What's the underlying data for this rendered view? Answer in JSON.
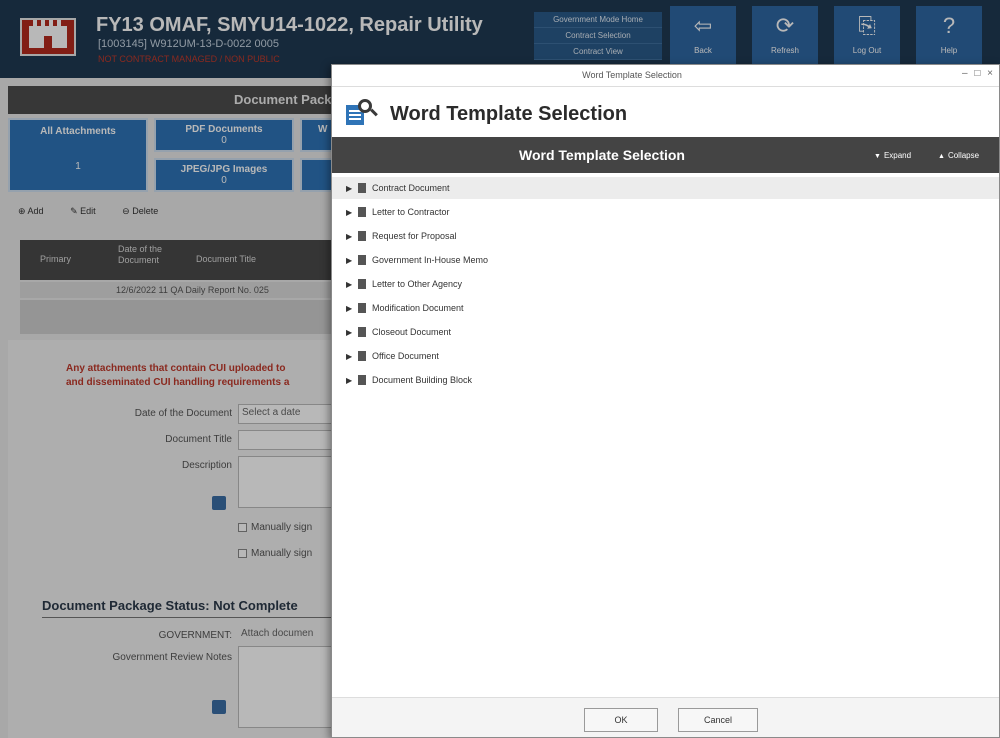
{
  "app": {
    "title": "FY13 OMAF, SMYU14-1022, Repair Utility",
    "subtitle": "[1003145] W912UM-13-D-0022 0005",
    "subtitle_note": "NOT CONTRACT MANAGED / NON PUBLIC",
    "header_links": [
      "Government Mode Home",
      "Contract Selection",
      "Contract View"
    ],
    "header_buttons": [
      {
        "label": "Back",
        "icon": "back-arrow-icon"
      },
      {
        "label": "Refresh",
        "icon": "refresh-icon"
      },
      {
        "label": "Log Out",
        "icon": "logout-icon"
      },
      {
        "label": "Help",
        "icon": "help-icon"
      }
    ],
    "document_title_bar": "Document Package",
    "tiles": {
      "all": {
        "label": "All Attachments",
        "count": "1"
      },
      "pdf": {
        "label": "PDF Documents",
        "count": "0"
      },
      "jpeg": {
        "label": "JPEG/JPG Images",
        "count": "0"
      },
      "word": {
        "label": "W"
      }
    },
    "toolbar": {
      "add": "Add",
      "edit": "Edit",
      "delete": "Delete"
    },
    "grid": {
      "columns": [
        "Primary",
        "Date of the Document",
        "Document Title"
      ],
      "row": "12/6/2022 11 QA Daily Report No. 025"
    },
    "warning_line1": "Any attachments that contain CUI uploaded to",
    "warning_line2": "and disseminated CUI handling requirements a",
    "form": {
      "date_label": "Date of the Document",
      "date_placeholder": "Select a date",
      "title_label": "Document Title",
      "description_label": "Description",
      "manual_sign_1": "Manually sign",
      "manual_sign_2": "Manually sign",
      "package_status": "Document Package Status: Not Complete",
      "government_label": "GOVERNMENT:",
      "government_value": "Attach documen",
      "review_notes_label": "Government Review Notes"
    }
  },
  "dialog": {
    "window_title": "Word Template Selection",
    "window_controls": "– □ ×",
    "heading": "Word Template Selection",
    "band_title": "Word Template Selection",
    "expand_label": "Expand",
    "collapse_label": "Collapse",
    "templates": [
      "Contract Document",
      "Letter to Contractor",
      "Request for Proposal",
      "Government In-House Memo",
      "Letter to Other Agency",
      "Modification Document",
      "Closeout Document",
      "Office Document",
      "Document Building Block"
    ],
    "ok_label": "OK",
    "cancel_label": "Cancel"
  }
}
